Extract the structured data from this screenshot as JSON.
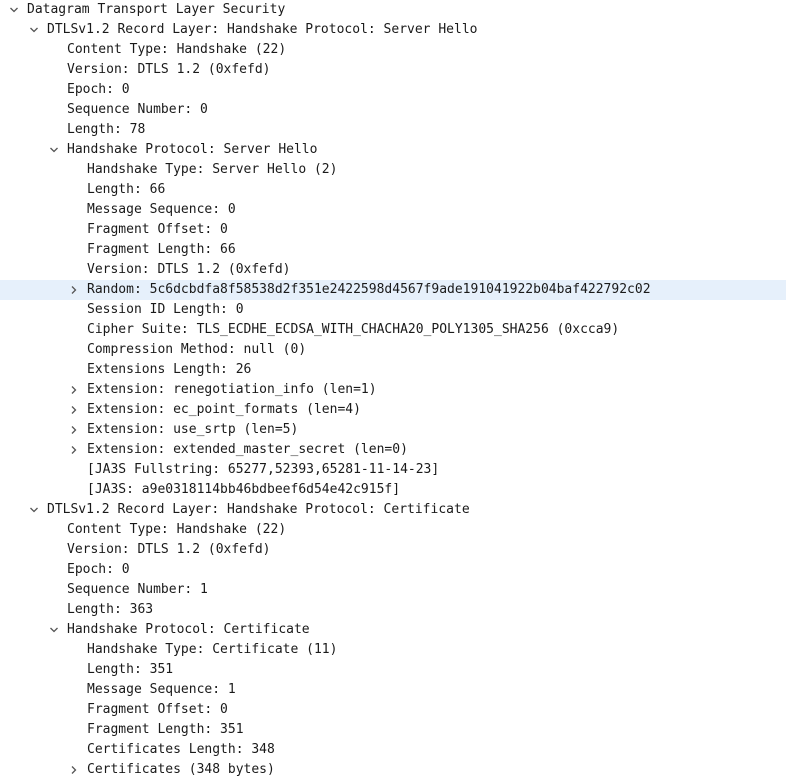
{
  "tree": [
    {
      "depth": 0,
      "toggle": "expanded",
      "text": "Datagram Transport Layer Security"
    },
    {
      "depth": 1,
      "toggle": "expanded",
      "text": "DTLSv1.2 Record Layer: Handshake Protocol: Server Hello"
    },
    {
      "depth": 2,
      "toggle": "none",
      "text": "Content Type: Handshake (22)"
    },
    {
      "depth": 2,
      "toggle": "none",
      "text": "Version: DTLS 1.2 (0xfefd)"
    },
    {
      "depth": 2,
      "toggle": "none",
      "text": "Epoch: 0"
    },
    {
      "depth": 2,
      "toggle": "none",
      "text": "Sequence Number: 0"
    },
    {
      "depth": 2,
      "toggle": "none",
      "text": "Length: 78"
    },
    {
      "depth": 2,
      "toggle": "expanded",
      "text": "Handshake Protocol: Server Hello"
    },
    {
      "depth": 3,
      "toggle": "none",
      "text": "Handshake Type: Server Hello (2)"
    },
    {
      "depth": 3,
      "toggle": "none",
      "text": "Length: 66"
    },
    {
      "depth": 3,
      "toggle": "none",
      "text": "Message Sequence: 0"
    },
    {
      "depth": 3,
      "toggle": "none",
      "text": "Fragment Offset: 0"
    },
    {
      "depth": 3,
      "toggle": "none",
      "text": "Fragment Length: 66"
    },
    {
      "depth": 3,
      "toggle": "none",
      "text": "Version: DTLS 1.2 (0xfefd)"
    },
    {
      "depth": 3,
      "toggle": "collapsed",
      "selected": true,
      "text": "Random: 5c6dcbdfa8f58538d2f351e2422598d4567f9ade191041922b04baf422792c02"
    },
    {
      "depth": 3,
      "toggle": "none",
      "text": "Session ID Length: 0"
    },
    {
      "depth": 3,
      "toggle": "none",
      "text": "Cipher Suite: TLS_ECDHE_ECDSA_WITH_CHACHA20_POLY1305_SHA256 (0xcca9)"
    },
    {
      "depth": 3,
      "toggle": "none",
      "text": "Compression Method: null (0)"
    },
    {
      "depth": 3,
      "toggle": "none",
      "text": "Extensions Length: 26"
    },
    {
      "depth": 3,
      "toggle": "collapsed",
      "text": "Extension: renegotiation_info (len=1)"
    },
    {
      "depth": 3,
      "toggle": "collapsed",
      "text": "Extension: ec_point_formats (len=4)"
    },
    {
      "depth": 3,
      "toggle": "collapsed",
      "text": "Extension: use_srtp (len=5)"
    },
    {
      "depth": 3,
      "toggle": "collapsed",
      "text": "Extension: extended_master_secret (len=0)"
    },
    {
      "depth": 3,
      "toggle": "none",
      "text": "[JA3S Fullstring: 65277,52393,65281-11-14-23]"
    },
    {
      "depth": 3,
      "toggle": "none",
      "text": "[JA3S: a9e0318114bb46bdbeef6d54e42c915f]"
    },
    {
      "depth": 1,
      "toggle": "expanded",
      "text": "DTLSv1.2 Record Layer: Handshake Protocol: Certificate"
    },
    {
      "depth": 2,
      "toggle": "none",
      "text": "Content Type: Handshake (22)"
    },
    {
      "depth": 2,
      "toggle": "none",
      "text": "Version: DTLS 1.2 (0xfefd)"
    },
    {
      "depth": 2,
      "toggle": "none",
      "text": "Epoch: 0"
    },
    {
      "depth": 2,
      "toggle": "none",
      "text": "Sequence Number: 1"
    },
    {
      "depth": 2,
      "toggle": "none",
      "text": "Length: 363"
    },
    {
      "depth": 2,
      "toggle": "expanded",
      "text": "Handshake Protocol: Certificate"
    },
    {
      "depth": 3,
      "toggle": "none",
      "text": "Handshake Type: Certificate (11)"
    },
    {
      "depth": 3,
      "toggle": "none",
      "text": "Length: 351"
    },
    {
      "depth": 3,
      "toggle": "none",
      "text": "Message Sequence: 1"
    },
    {
      "depth": 3,
      "toggle": "none",
      "text": "Fragment Offset: 0"
    },
    {
      "depth": 3,
      "toggle": "none",
      "text": "Fragment Length: 351"
    },
    {
      "depth": 3,
      "toggle": "none",
      "text": "Certificates Length: 348"
    },
    {
      "depth": 3,
      "toggle": "collapsed",
      "text": "Certificates (348 bytes)"
    }
  ],
  "colors": {
    "selected_row": "#e6f0fb",
    "text": "#1a1a1a",
    "arrow": "#555555"
  }
}
